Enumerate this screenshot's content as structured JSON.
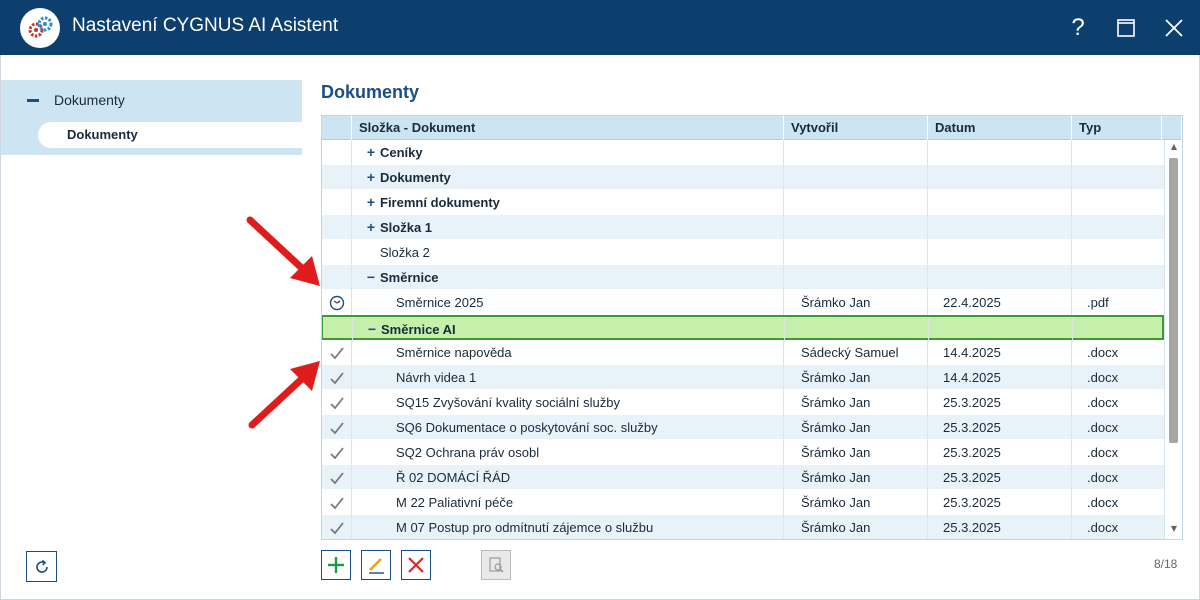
{
  "window": {
    "title": "Nastavení CYGNUS AI Asistent",
    "help_label": "?"
  },
  "sidebar": {
    "group_label": "Dokumenty",
    "items": [
      {
        "label": "Dokumenty"
      }
    ]
  },
  "main": {
    "section_title": "Dokumenty",
    "columns": [
      "Složka - Dokument",
      "Vytvořil",
      "Datum",
      "Typ"
    ],
    "rows": [
      {
        "kind": "folder",
        "toggle": "+",
        "label": "Ceníky",
        "bold": true
      },
      {
        "kind": "folder",
        "toggle": "+",
        "label": "Dokumenty",
        "bold": true
      },
      {
        "kind": "folder",
        "toggle": "+",
        "label": "Firemní dokumenty",
        "bold": true
      },
      {
        "kind": "folder",
        "toggle": "+",
        "label": "Složka 1",
        "bold": true
      },
      {
        "kind": "folder",
        "toggle": "",
        "label": "Složka 2",
        "bold": false
      },
      {
        "kind": "folder",
        "toggle": "−",
        "label": "Směrnice",
        "bold": true
      },
      {
        "kind": "doc",
        "status": "clock",
        "label": "Směrnice 2025",
        "author": "Šrámko Jan",
        "date": "22.4.2025",
        "type": ".pdf"
      },
      {
        "kind": "folder",
        "toggle": "−",
        "label": "Směrnice AI",
        "bold": true,
        "selected": true
      },
      {
        "kind": "doc",
        "status": "check",
        "label": "Směrnice napověda",
        "author": "Sádecký Samuel",
        "date": "14.4.2025",
        "type": ".docx"
      },
      {
        "kind": "doc",
        "status": "check",
        "label": "Návrh videa 1",
        "author": "Šrámko Jan",
        "date": "14.4.2025",
        "type": ".docx"
      },
      {
        "kind": "doc",
        "status": "check",
        "label": "SQ15 Zvyšování kvality sociální služby",
        "author": "Šrámko Jan",
        "date": "25.3.2025",
        "type": ".docx"
      },
      {
        "kind": "doc",
        "status": "check",
        "label": "SQ6 Dokumentace o poskytování soc. služby",
        "author": "Šrámko Jan",
        "date": "25.3.2025",
        "type": ".docx"
      },
      {
        "kind": "doc",
        "status": "check",
        "label": "SQ2 Ochrana práv osobl",
        "author": "Šrámko Jan",
        "date": "25.3.2025",
        "type": ".docx"
      },
      {
        "kind": "doc",
        "status": "check",
        "label": "Ř 02 DOMÁCÍ ŘÁD",
        "author": "Šrámko Jan",
        "date": "25.3.2025",
        "type": ".docx"
      },
      {
        "kind": "doc",
        "status": "check",
        "label": "M 22 Paliativní péče",
        "author": "Šrámko Jan",
        "date": "25.3.2025",
        "type": ".docx"
      },
      {
        "kind": "doc",
        "status": "check",
        "label": "M 07 Postup pro odmítnutí zájemce o službu",
        "author": "Šrámko Jan",
        "date": "25.3.2025",
        "type": ".docx"
      }
    ],
    "pager": "8/18"
  },
  "colors": {
    "titlebar": "#0c3f6d",
    "accent": "#1a4f86",
    "selection": "#c6efab",
    "annotation_arrow": "#e01b1b"
  }
}
